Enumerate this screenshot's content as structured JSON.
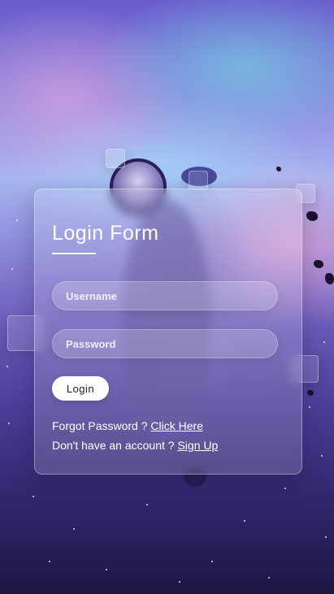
{
  "login_form": {
    "title": "Login Form",
    "username": {
      "placeholder": "Username",
      "value": ""
    },
    "password": {
      "placeholder": "Password",
      "value": ""
    },
    "login_button": "Login",
    "forgot": {
      "text": "Forgot Password ? ",
      "link": "Click Here"
    },
    "signup": {
      "text": "Don't have an account ? ",
      "link": "Sign Up"
    }
  },
  "colors": {
    "button_bg": "#ffffff",
    "text": "#ffffff"
  }
}
